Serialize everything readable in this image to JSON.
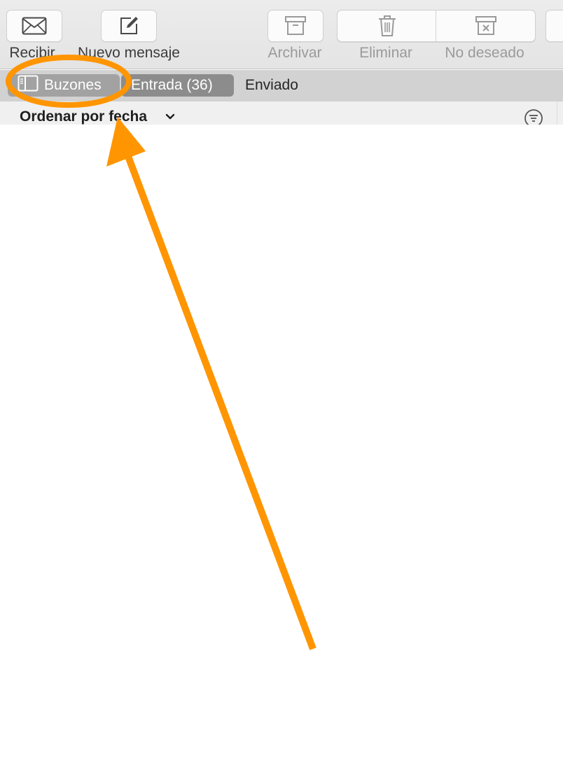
{
  "toolbar": {
    "buttons": [
      {
        "label": "Recibir",
        "icon": "envelope-icon",
        "enabled": true
      },
      {
        "label": "Nuevo mensaje",
        "icon": "compose-icon",
        "enabled": true
      },
      {
        "label": "Archivar",
        "icon": "archive-box-icon",
        "enabled": false
      },
      {
        "label": "Eliminar",
        "icon": "trash-icon",
        "enabled": false
      },
      {
        "label": "No deseado",
        "icon": "junk-box-icon",
        "enabled": false
      }
    ]
  },
  "tabs": [
    {
      "label": "Buzones",
      "icon": "sidebar-icon",
      "state": "highlighted"
    },
    {
      "label": "Entrada (36)",
      "state": "selected"
    },
    {
      "label": "Enviado",
      "state": "normal"
    }
  ],
  "sort": {
    "label": "Ordenar por fecha",
    "chevron_icon": "chevron-down-icon",
    "filter_icon": "filter-icon"
  },
  "annotation": {
    "color": "#ff9500",
    "shapes": [
      "highlight-ellipse",
      "pointer-arrow"
    ]
  }
}
